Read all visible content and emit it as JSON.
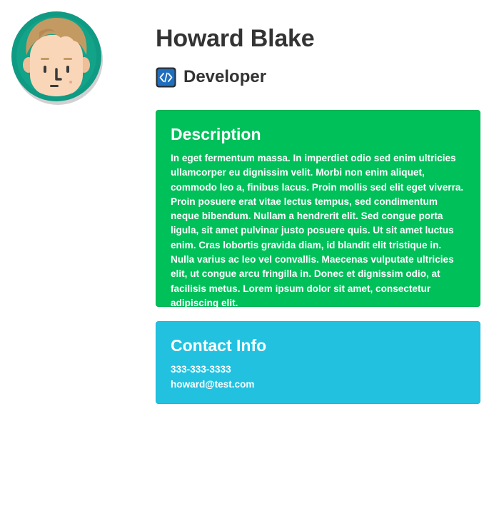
{
  "profile": {
    "name": "Howard Blake",
    "role": "Developer",
    "avatar_icon": "boy-avatar-icon",
    "role_icon": "code-icon"
  },
  "description": {
    "heading": "Description",
    "body": "In eget fermentum massa. In imperdiet odio sed enim ultricies ullamcorper eu dignissim velit. Morbi non enim aliquet, commodo leo a, finibus lacus. Proin mollis sed elit eget viverra. Proin posuere erat vitae lectus tempus, sed condimentum neque bibendum. Nullam a hendrerit elit. Sed congue porta ligula, sit amet pulvinar justo posuere quis. Ut sit amet luctus enim. Cras lobortis gravida diam, id blandit elit tristique in. Nulla varius ac leo vel convallis. Maecenas vulputate ultricies elit, ut congue arcu fringilla in. Donec et dignissim odio, at facilisis metus. Lorem ipsum dolor sit amet, consectetur adipiscing elit."
  },
  "contact": {
    "heading": "Contact Info",
    "phone": "333-333-3333",
    "email": "howard@test.com"
  },
  "colors": {
    "description_bg": "#00c05a",
    "contact_bg": "#23c1e0",
    "avatar_ring": "#0f9a84",
    "code_icon_bg": "#1f6fbf"
  }
}
